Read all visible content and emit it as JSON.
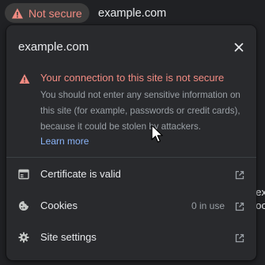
{
  "omnibox": {
    "security_chip_label": "Not secure",
    "url": "example.com"
  },
  "background_page": {
    "fragments": [
      "ex",
      "oc"
    ]
  },
  "popup": {
    "site": "example.com",
    "alert": {
      "title": "Your connection to this site is not secure",
      "body": "You should not enter any sensitive information on this site (for example, passwords or credit cards), because it could be stolen by attackers.",
      "link": "Learn more"
    },
    "rows": [
      {
        "label": "Certificate is valid",
        "value": "",
        "icon": "certificate-icon"
      },
      {
        "label": "Cookies",
        "value": "0 in use",
        "icon": "cookie-icon"
      },
      {
        "label": "Site settings",
        "value": "",
        "icon": "gear-icon"
      }
    ]
  },
  "colors": {
    "warning": "#f28b82",
    "link": "#8ab4f8",
    "popup_bg": "#292a2d",
    "page_bg": "#202124"
  }
}
